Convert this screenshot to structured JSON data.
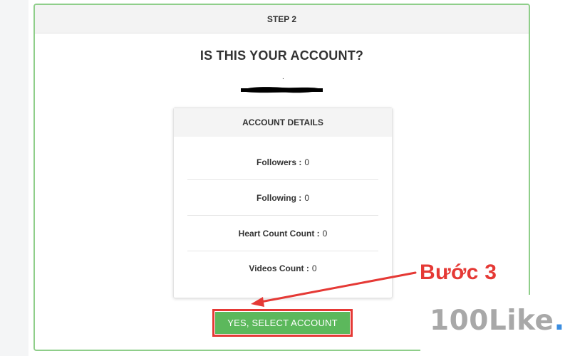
{
  "step_card": {
    "header": "STEP 2",
    "question": "IS THIS YOUR ACCOUNT?",
    "handle_mark": "."
  },
  "account_details": {
    "header": "ACCOUNT DETAILS",
    "rows": [
      {
        "label": "Followers :",
        "value": "0"
      },
      {
        "label": "Following :",
        "value": "0"
      },
      {
        "label": "Heart Count Count :",
        "value": "0"
      },
      {
        "label": "Videos Count :",
        "value": "0"
      }
    ]
  },
  "actions": {
    "select_label": "YES, SELECT ACCOUNT"
  },
  "annotation": {
    "step_text": "Bước 3"
  },
  "watermark": {
    "brand": "100Like",
    "dot": "."
  },
  "colors": {
    "card_border": "#8fce8a",
    "button_green": "#5cb85c",
    "annotation_red": "#e53935",
    "watermark_gray": "#a8a8a8",
    "watermark_dot_blue": "#3b8de0"
  },
  "icons": {
    "pointer": "arrow-icon"
  }
}
